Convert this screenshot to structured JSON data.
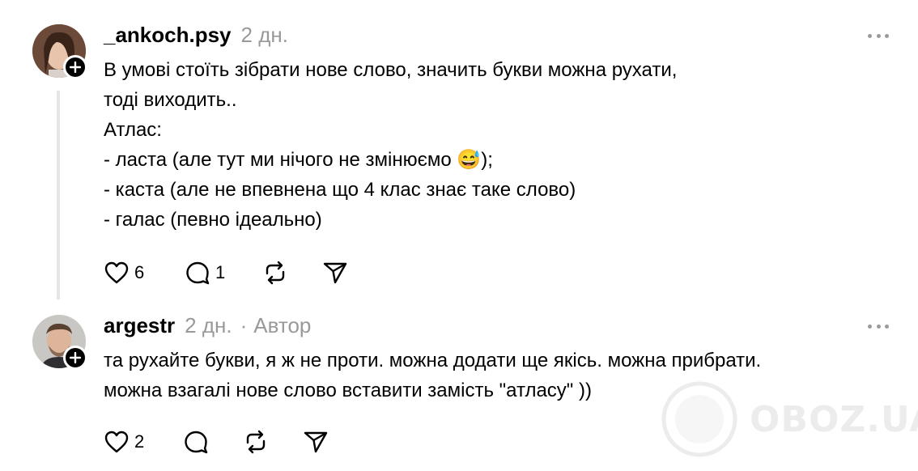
{
  "posts": [
    {
      "username": "_ankoch.psy",
      "time": "2 дн.",
      "author_tag": "",
      "lines": [
        "В умові стоїть зібрати нове слово, значить букви можна рухати,",
        "тоді виходить..",
        "Атлас:",
        "- ласта (але тут ми нічого не змінюємо 😅);",
        "- каста (але не впевнена що 4 клас знає таке слово)",
        "- галас (певно ідеально)"
      ],
      "likes": "6",
      "replies": "1",
      "reposts": "",
      "shares": ""
    },
    {
      "username": "argestr",
      "time": "2 дн.",
      "separator": "·",
      "author_tag": "Автор",
      "lines": [
        "та рухайте букви, я ж не проти. можна додати ще якісь. можна прибрати.",
        "можна взагалі нове слово вставити замість \"атласу\" ))"
      ],
      "likes": "2",
      "replies": "",
      "reposts": "",
      "shares": ""
    }
  ],
  "icons": {
    "like": "heart-icon",
    "reply": "comment-icon",
    "repost": "repost-icon",
    "share": "send-icon",
    "more": "more-horizontal-icon",
    "follow": "plus-icon"
  },
  "watermark": {
    "text": "OBOZ.UA"
  },
  "colors": {
    "text": "#000000",
    "muted": "#999999",
    "thread": "#e5e5e5"
  }
}
